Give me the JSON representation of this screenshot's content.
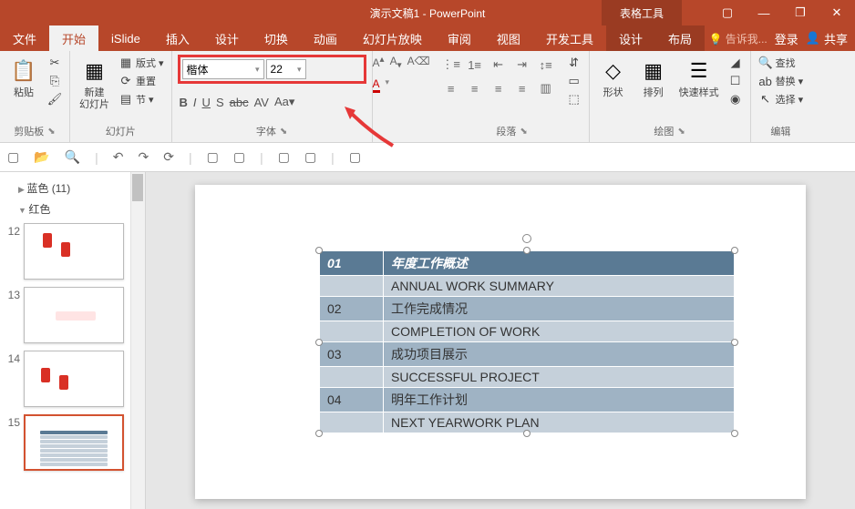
{
  "titlebar": {
    "doc_title": "演示文稿1 - PowerPoint",
    "tool_context": "表格工具"
  },
  "tabs": {
    "file": "文件",
    "home": "开始",
    "islide": "iSlide",
    "insert": "插入",
    "design": "设计",
    "transitions": "切换",
    "animations": "动画",
    "slideshow": "幻灯片放映",
    "review": "审阅",
    "view": "视图",
    "developer": "开发工具",
    "tbl_design": "设计",
    "tbl_layout": "布局",
    "tell_me": "告诉我...",
    "login": "登录",
    "share": "共享"
  },
  "ribbon": {
    "clipboard": {
      "label": "剪贴板",
      "paste": "粘贴"
    },
    "slides": {
      "label": "幻灯片",
      "new_slide": "新建\n幻灯片",
      "layout": "版式",
      "reset": "重置",
      "section": "节"
    },
    "font": {
      "label": "字体",
      "name": "楷体",
      "size": "22"
    },
    "paragraph": {
      "label": "段落"
    },
    "drawing": {
      "label": "绘图",
      "shapes": "形状",
      "arrange": "排列",
      "quick_styles": "快速样式"
    },
    "editing": {
      "label": "编辑",
      "find": "查找",
      "replace": "替换",
      "select": "选择"
    }
  },
  "outline": {
    "group_blue": "蓝色 (11)",
    "group_red": "红色"
  },
  "thumbs": {
    "n12": "12",
    "n13": "13",
    "n14": "14",
    "n15": "15"
  },
  "table_data": {
    "rows": [
      {
        "num": "01",
        "zh": "年度工作概述",
        "en": "ANNUAL WORK SUMMARY",
        "header": true
      },
      {
        "num": "02",
        "zh": "工作完成情况",
        "en": "COMPLETION OF WORK"
      },
      {
        "num": "03",
        "zh": "成功项目展示",
        "en": "SUCCESSFUL PROJECT"
      },
      {
        "num": "04",
        "zh": "明年工作计划",
        "en": "NEXT YEARWORK PLAN"
      }
    ]
  }
}
